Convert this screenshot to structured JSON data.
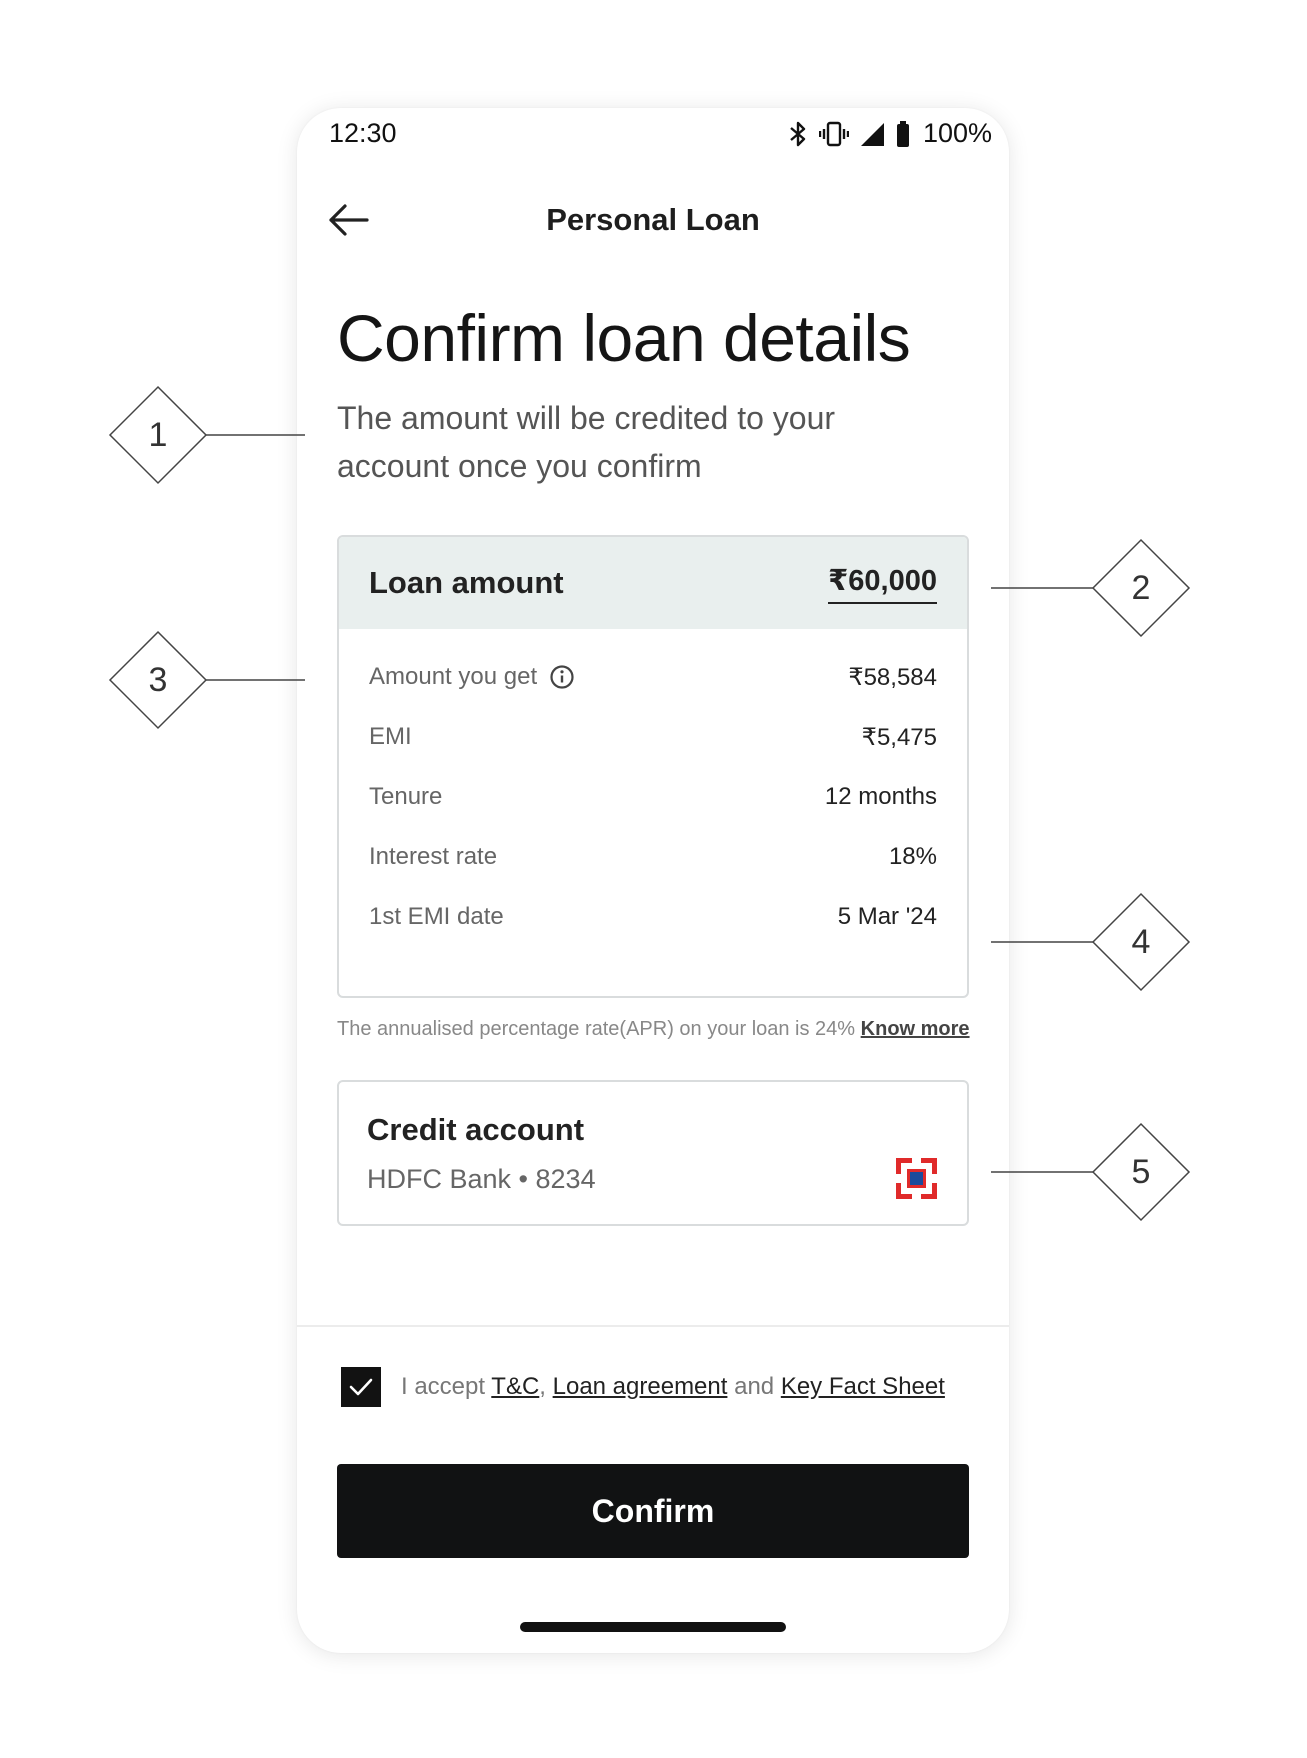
{
  "status_bar": {
    "time": "12:30",
    "battery_text": "100%",
    "icons": [
      "bluetooth-icon",
      "vibrate-icon",
      "signal-icon",
      "battery-icon"
    ]
  },
  "header": {
    "title": "Personal Loan",
    "back_icon": "arrow-left-icon"
  },
  "page": {
    "title": "Confirm loan details",
    "subtitle": "The amount will be credited to your account once you confirm"
  },
  "loan_card": {
    "amount_label": "Loan amount",
    "amount_value": "₹60,000",
    "header_bg": "#e9efee",
    "rows": [
      {
        "label": "Amount you get",
        "value": "₹58,584",
        "icon": "info-icon"
      },
      {
        "label": "EMI",
        "value": "₹5,475"
      },
      {
        "label": "Tenure",
        "value": "12 months"
      },
      {
        "label": "Interest rate",
        "value": "18%"
      },
      {
        "label": "1st EMI date",
        "value": "5 Mar '24"
      }
    ]
  },
  "apr_note": {
    "text": "The annualised percentage rate(APR) on your loan is 24% ",
    "link": "Know more"
  },
  "credit_account": {
    "title": "Credit account",
    "bank": "HDFC Bank",
    "separator": "•",
    "account_last4": "8234",
    "logo_icon": "hdfc-bank-logo-icon",
    "logo_colors": {
      "red": "#e02a2a",
      "blue": "#1a4b9c"
    }
  },
  "consent": {
    "checked": true,
    "prefix": "I accept ",
    "tc_link": "T&C",
    "comma": ", ",
    "agreement_link": "Loan agreement",
    "and_text": " and ",
    "kfs_link": "Key Fact Sheet"
  },
  "confirm_button": {
    "label": "Confirm",
    "bg": "#111213"
  },
  "callouts": [
    "1",
    "2",
    "3",
    "4",
    "5"
  ]
}
